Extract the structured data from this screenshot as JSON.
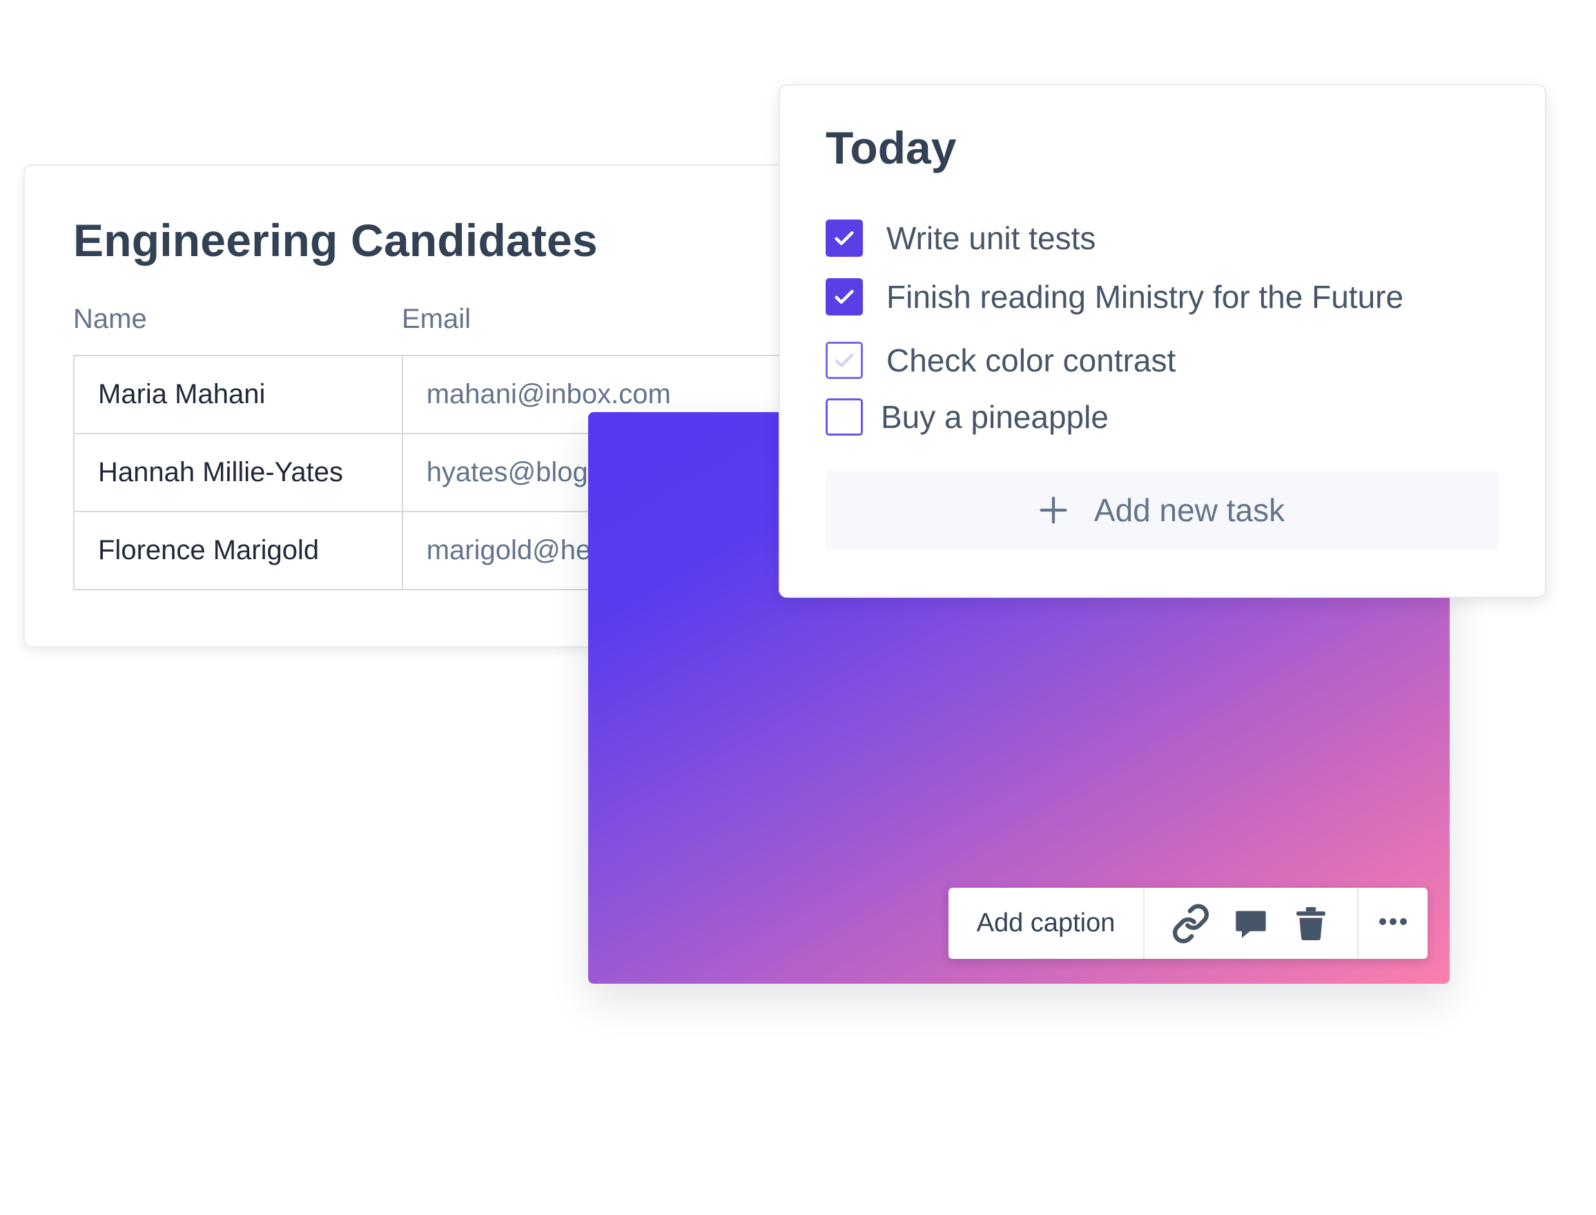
{
  "candidates": {
    "title": "Engineering Candidates",
    "columns": [
      "Name",
      "Email"
    ],
    "rows": [
      {
        "name": "Maria Mahani",
        "email": "mahani@inbox.com"
      },
      {
        "name": "Hannah Millie-Yates",
        "email": "hyates@blog.net"
      },
      {
        "name": "Florence Marigold",
        "email": "marigold@hey.com"
      }
    ]
  },
  "today": {
    "title": "Today",
    "tasks": [
      {
        "label": "Write unit tests",
        "state": "checked"
      },
      {
        "label": "Finish reading Ministry for the Future",
        "state": "checked"
      },
      {
        "label": "Check color contrast",
        "state": "faint"
      },
      {
        "label": "Buy a pineapple",
        "state": "unchecked"
      }
    ],
    "add_task_label": "Add new task"
  },
  "image_toolbar": {
    "caption_label": "Add caption",
    "icons": [
      "link-icon",
      "comment-icon",
      "trash-icon",
      "more-icon"
    ]
  },
  "colors": {
    "accent": "#5a3fe6",
    "gradient_start": "#5637f2",
    "gradient_end": "#fb7fad",
    "text_primary": "#334155",
    "text_muted": "#64748b"
  }
}
